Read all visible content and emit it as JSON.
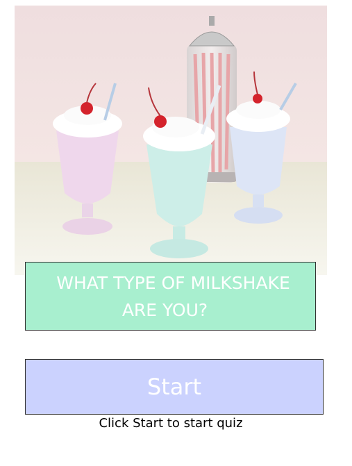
{
  "hero_image": {
    "description_icon": "milkshake-photo"
  },
  "title": {
    "line1": "WHAT TYPE OF MILKSHAKE",
    "line2": "ARE YOU?"
  },
  "start_button": {
    "label": "Start"
  },
  "hint": {
    "text": "Click Start to start quiz"
  },
  "colors": {
    "title_bg": "#a8efcf",
    "start_bg": "#cbd2fe",
    "text_on_color": "#ffffff"
  }
}
